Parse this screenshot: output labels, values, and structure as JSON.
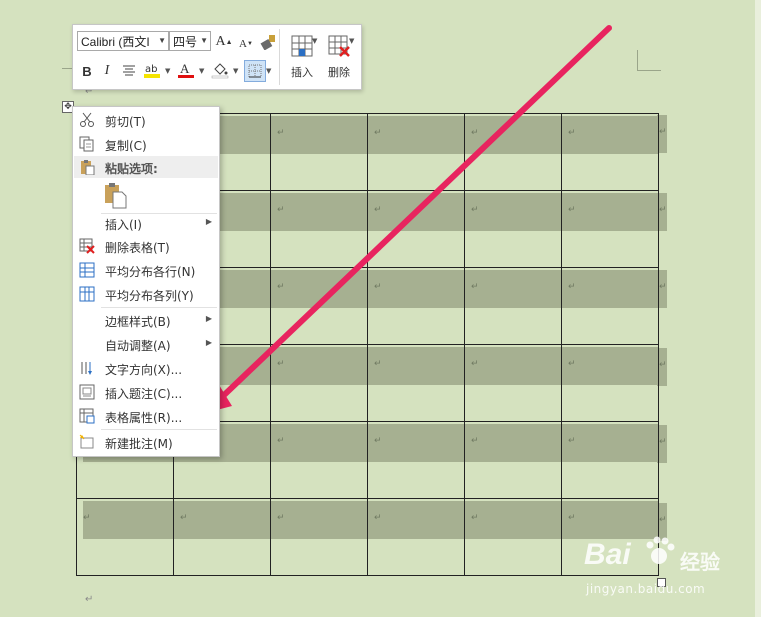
{
  "toolbar": {
    "font_name": "Calibri (西文I",
    "font_size": "四号",
    "insert_label": "插入",
    "delete_label": "删除"
  },
  "context_menu": {
    "cut": "剪切(T)",
    "copy": "复制(C)",
    "paste_options": "粘贴选项:",
    "insert": "插入(I)",
    "delete_table": "删除表格(T)",
    "distribute_rows": "平均分布各行(N)",
    "distribute_columns": "平均分布各列(Y)",
    "border_styles": "边框样式(B)",
    "autofit": "自动调整(A)",
    "text_direction": "文字方向(X)...",
    "insert_caption": "插入题注(C)...",
    "table_properties": "表格属性(R)...",
    "new_comment": "新建批注(M)"
  },
  "document": {
    "paragraph_mark": "↵",
    "cell_mark": "↵",
    "rows": 6,
    "columns": 6
  },
  "watermark": {
    "brand": "Bai",
    "brand_tail": "经验",
    "url": "jingyan.baidu.com"
  },
  "colors": {
    "page": "#d5e2bf",
    "cell_shading": "#a6b091",
    "arrow": "#e8245f"
  }
}
